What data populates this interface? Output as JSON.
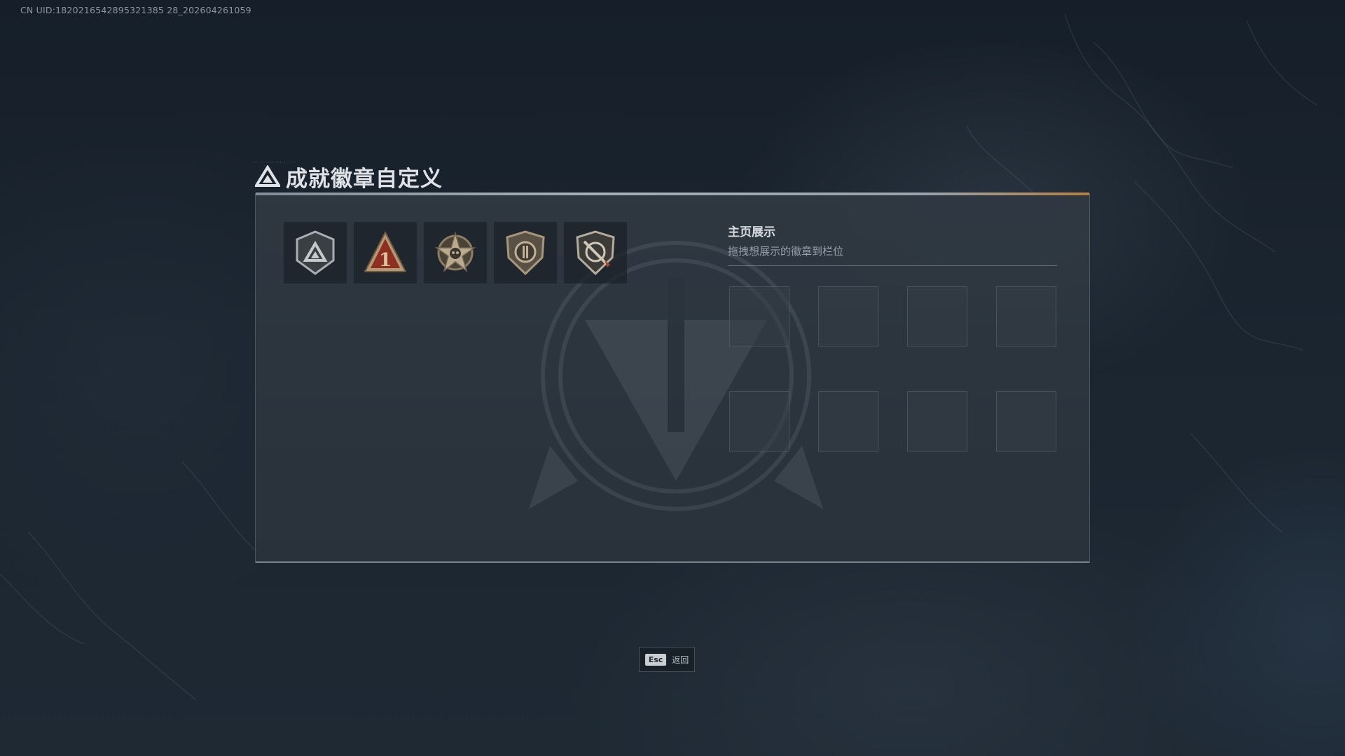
{
  "uid_text": "CN UID:1820216542895321385 28_202604261059",
  "header": {
    "title": "成就徽章自定义",
    "icon": "triangle-emblem-icon"
  },
  "badges": [
    {
      "name": "badge-shield-triangle",
      "icon": "shield-triangle-icon"
    },
    {
      "name": "badge-red-one",
      "icon": "red-triangle-number-one-icon"
    },
    {
      "name": "badge-star-skull",
      "icon": "star-skull-icon"
    },
    {
      "name": "badge-shield-fist",
      "icon": "shield-fist-icon"
    },
    {
      "name": "badge-shield-scope",
      "icon": "shield-crossed-scope-icon"
    }
  ],
  "showcase": {
    "title": "主页展示",
    "subtitle": "拖拽想展示的徽章到栏位",
    "slot_count": 8
  },
  "footer": {
    "esc_key": "Esc",
    "esc_label": "返回"
  },
  "colors": {
    "background": "#1b2530",
    "panel": "#2e3741",
    "accent_orange": "#c98a3c",
    "badge_red": "#8f2f22"
  }
}
